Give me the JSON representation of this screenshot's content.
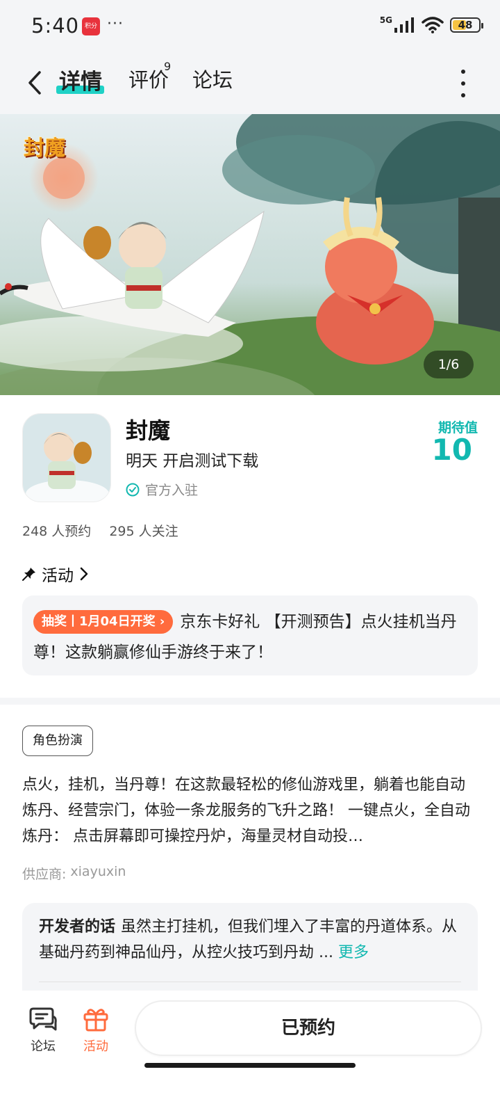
{
  "status_bar": {
    "time": "5:40",
    "notification_app_label": "积分",
    "more_dots": "···",
    "network": "5G",
    "battery_level": "48"
  },
  "nav": {
    "tabs": [
      {
        "label": "详情",
        "active": true
      },
      {
        "label": "评价",
        "count": "9"
      },
      {
        "label": "论坛"
      }
    ]
  },
  "banner": {
    "logo_text": "封魔",
    "counter": "1/6"
  },
  "app": {
    "name": "封魔",
    "subtitle": "明天 开启测试下载",
    "official_label": "官方入驻",
    "expect_label": "期待值",
    "expect_value": "10",
    "reservations": "248 人预约",
    "followers": "295 人关注"
  },
  "activity": {
    "heading": "活动",
    "badge": "抽奖丨1月04日开奖",
    "text": "京东卡好礼 【开测预告】点火挂机当丹尊！这款躺赢修仙手游终于来了！"
  },
  "details": {
    "genre_tag": "角色扮演",
    "description": "点火，挂机，当丹尊！在这款最轻松的修仙游戏里，躺着也能自动炼丹、经营宗门，体验一条龙服务的飞升之路！ 一键点火，全自动炼丹： 点击屏幕即可操控丹炉，海量灵材自动投…",
    "supplier_label": "供应商:",
    "supplier_name": "xiayuxin"
  },
  "developer_note": {
    "title": "开发者的话",
    "text": "虽然主打挂机，但我们埋入了丰富的丹道体系。从基础丹药到神品仙丹，从控火技巧到丹劫 ...",
    "more_label": "更多"
  },
  "bottom_bar": {
    "forum_label": "论坛",
    "activity_label": "活动",
    "reserve_label": "已预约"
  },
  "colors": {
    "accent": "#12b8b0",
    "tab_underline": "#1fd1c6",
    "lottery": "#ff6b3d",
    "card_bg": "#f4f5f7"
  }
}
